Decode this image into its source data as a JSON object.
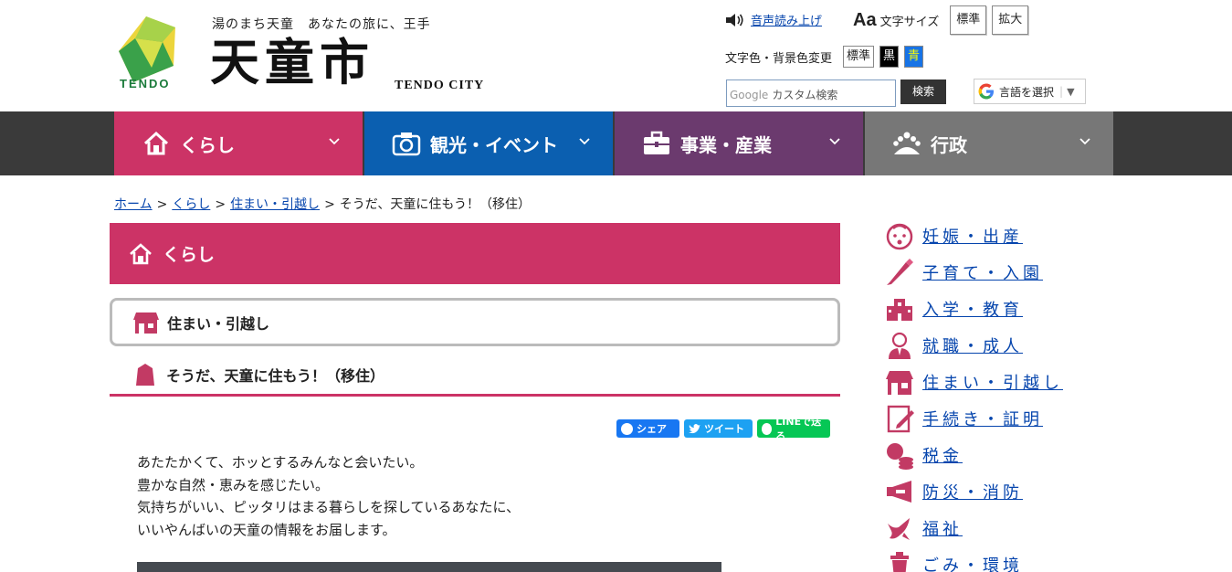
{
  "header": {
    "tagline": "湯のまち天童　あなたの旅に、王手",
    "logo_text": "TENDO",
    "city_name": "天童市",
    "city_en": "TENDO CITY",
    "speech_label": "音声読み上げ",
    "fontsize_label": "文字サイズ",
    "fontsize_standard": "標準",
    "fontsize_large": "拡大",
    "color_label": "文字色・背景色変更",
    "color_standard": "標準",
    "color_black": "黒",
    "color_blue": "青",
    "search_brand": "Google",
    "search_placeholder": "カスタム検索",
    "search_button": "検索",
    "language_label": "言語を選択"
  },
  "nav": {
    "items": [
      {
        "label": "くらし",
        "color": "#cc3366"
      },
      {
        "label": "観光・イベント",
        "color": "#0b5fb0"
      },
      {
        "label": "事業・産業",
        "color": "#6b3a6e"
      },
      {
        "label": "行政",
        "color": "#777777"
      }
    ]
  },
  "breadcrumb": {
    "items": [
      "ホーム",
      "くらし",
      "住まい・引越し"
    ],
    "current": "そうだ、天童に住もう！（移住）"
  },
  "main": {
    "category": "くらし",
    "subcategory": "住まい・引越し",
    "title": "そうだ、天童に住もう！（移住）",
    "share": {
      "facebook": "シェア",
      "twitter": "ツイート",
      "line": "LINEで送る"
    },
    "intro_lines": [
      "あたたかくて、ホッとするみんなと会いたい。",
      "豊かな自然・恵みを感じたい。",
      "気持ちがいい、ピッタリはまる暮らしを探しているあなたに、",
      "いいやんばいの天童の情報をお届します。"
    ]
  },
  "sidebar": {
    "items": [
      {
        "label": "妊娠・出産",
        "icon": "baby-icon"
      },
      {
        "label": "子育て・入園",
        "icon": "crayon-icon"
      },
      {
        "label": "入学・教育",
        "icon": "school-icon"
      },
      {
        "label": "就職・成人",
        "icon": "person-icon"
      },
      {
        "label": "住まい・引越し",
        "icon": "house-icon"
      },
      {
        "label": "手続き・証明",
        "icon": "document-icon"
      },
      {
        "label": "税金",
        "icon": "coins-icon"
      },
      {
        "label": "防災・消防",
        "icon": "megaphone-icon"
      },
      {
        "label": "福祉",
        "icon": "bird-icon"
      },
      {
        "label": "ごみ・環境",
        "icon": "trash-icon"
      }
    ],
    "icon_color": "#c23a64"
  }
}
